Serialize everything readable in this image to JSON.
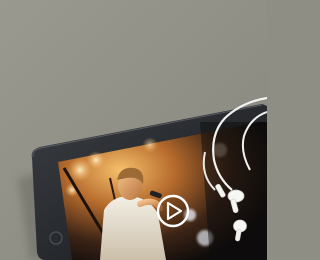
{
  "scene": {
    "description_kind": "photo",
    "background_color": "#8f8e85",
    "tablet": {
      "frame_color": "#24262a",
      "screen_content": "concert-performer-video"
    },
    "video_player": {
      "play_icon": "play-icon"
    },
    "earphones": {
      "color": "#f2f2f0"
    }
  }
}
